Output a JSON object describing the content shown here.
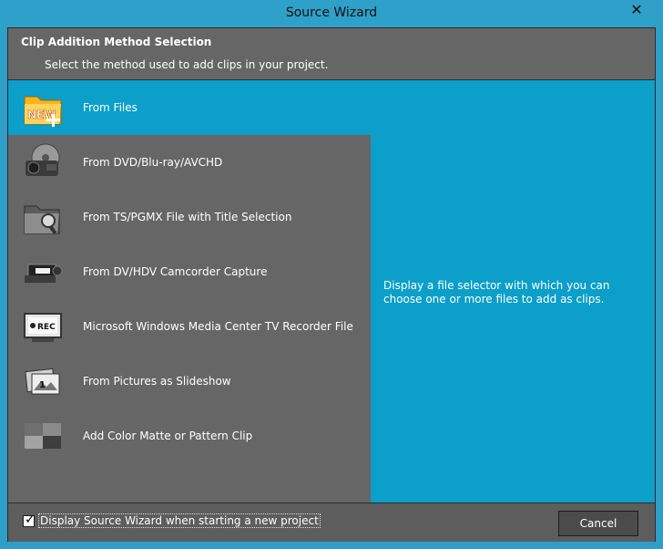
{
  "window": {
    "title": "Source Wizard",
    "close_label": "✕"
  },
  "header": {
    "title": "Clip Addition Method Selection",
    "subtitle": "Select the method used to add clips in your project."
  },
  "items": [
    {
      "label": "From Files",
      "icon": "new-folder-icon",
      "selected": true
    },
    {
      "label": "From DVD/Blu-ray/AVCHD",
      "icon": "camcorder-disc-icon",
      "selected": false
    },
    {
      "label": "From TS/PGMX File with Title Selection",
      "icon": "folder-magnifier-icon",
      "selected": false
    },
    {
      "label": "From DV/HDV Camcorder Capture",
      "icon": "dv-camcorder-icon",
      "selected": false
    },
    {
      "label": "Microsoft Windows Media Center TV Recorder File",
      "icon": "tv-recorder-icon",
      "selected": false
    },
    {
      "label": "From Pictures as Slideshow",
      "icon": "slideshow-pictures-icon",
      "selected": false
    },
    {
      "label": "Add Color Matte or Pattern Clip",
      "icon": "color-matte-icon",
      "selected": false
    }
  ],
  "description": "Display a file selector with which you can choose one or more files to add as clips.",
  "footer": {
    "checkbox_label": "Display Source Wizard when starting a new project",
    "checked": true,
    "cancel_label": "Cancel"
  },
  "colors": {
    "accent": "#0b9fca",
    "panel": "#666666"
  }
}
